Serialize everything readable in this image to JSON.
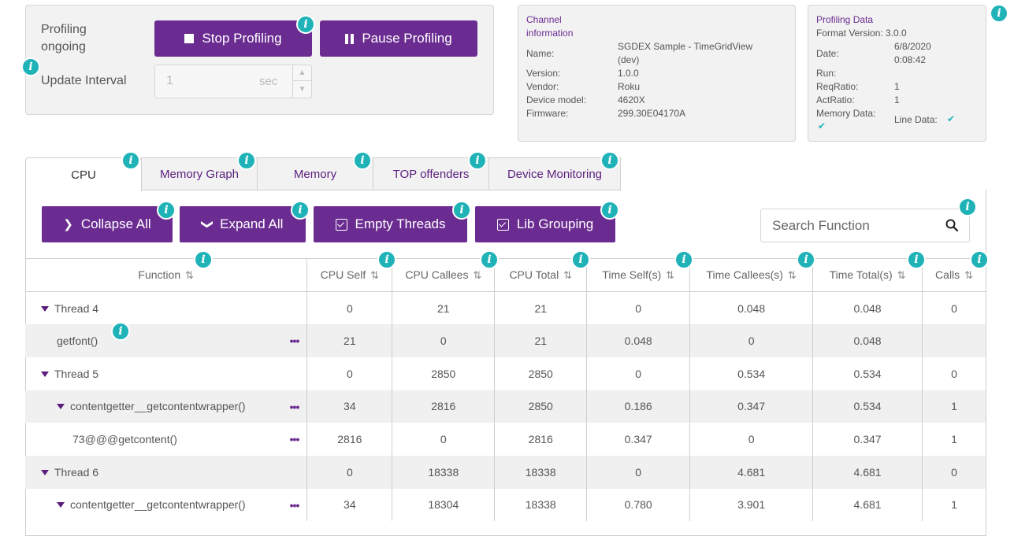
{
  "controls": {
    "status_label": "Profiling ongoing",
    "stop_label": "Stop Profiling",
    "pause_label": "Pause Profiling",
    "interval_label": "Update Interval",
    "interval_value": "1",
    "interval_unit": "sec"
  },
  "channel": {
    "title_line1": "Channel",
    "title_line2": "information",
    "fields": [
      {
        "key": "Name:",
        "value_line1": "SGDEX Sample - TimeGridView",
        "value_line2": "(dev)"
      },
      {
        "key": "Version:",
        "value_line1": "1.0.0"
      },
      {
        "key": "Vendor:",
        "value_line1": "Roku"
      },
      {
        "key": "Device model:",
        "value_line1": "4620X"
      },
      {
        "key": "Firmware:",
        "value_line1": "299.30E04170A"
      }
    ]
  },
  "profiling": {
    "title": "Profiling Data",
    "format_version": "Format Version: 3.0.0",
    "date_key": "Date:",
    "date_value": "6/8/2020",
    "time_value": "0:08:42",
    "run_key": "Run:",
    "req_key": "ReqRatio:",
    "req_value": "1",
    "act_key": "ActRatio:",
    "act_value": "1",
    "memory_key": "Memory Data:",
    "line_key": "Line Data:"
  },
  "tabs": [
    "CPU",
    "Memory Graph",
    "Memory",
    "TOP offenders",
    "Device Monitoring"
  ],
  "toolbar": {
    "collapse": "Collapse All",
    "expand": "Expand All",
    "empty_threads": "Empty Threads",
    "lib_grouping": "Lib Grouping",
    "search_placeholder": "Search Function"
  },
  "table": {
    "headers": [
      "Function",
      "CPU Self",
      "CPU Callees",
      "CPU Total",
      "Time Self(s)",
      "Time Callees(s)",
      "Time Total(s)",
      "Calls"
    ],
    "rows": [
      {
        "fn": "Thread 4",
        "cells": [
          "0",
          "21",
          "21",
          "0",
          "0.048",
          "0.048",
          "0"
        ]
      },
      {
        "fn": "getfont()",
        "cells": [
          "21",
          "0",
          "21",
          "0.048",
          "0",
          "0.048",
          ""
        ]
      },
      {
        "fn": "Thread 5",
        "cells": [
          "0",
          "2850",
          "2850",
          "0",
          "0.534",
          "0.534",
          "0"
        ]
      },
      {
        "fn": "contentgetter__getcontentwrapper()",
        "cells": [
          "34",
          "2816",
          "2850",
          "0.186",
          "0.347",
          "0.534",
          "1"
        ]
      },
      {
        "fn": "73@@@getcontent()",
        "cells": [
          "2816",
          "0",
          "2816",
          "0.347",
          "0",
          "0.347",
          "1"
        ]
      },
      {
        "fn": "Thread 6",
        "cells": [
          "0",
          "18338",
          "18338",
          "0",
          "4.681",
          "4.681",
          "0"
        ]
      },
      {
        "fn": "contentgetter__getcontentwrapper()",
        "cells": [
          "34",
          "18304",
          "18338",
          "0.780",
          "3.901",
          "4.681",
          "1"
        ]
      }
    ]
  }
}
